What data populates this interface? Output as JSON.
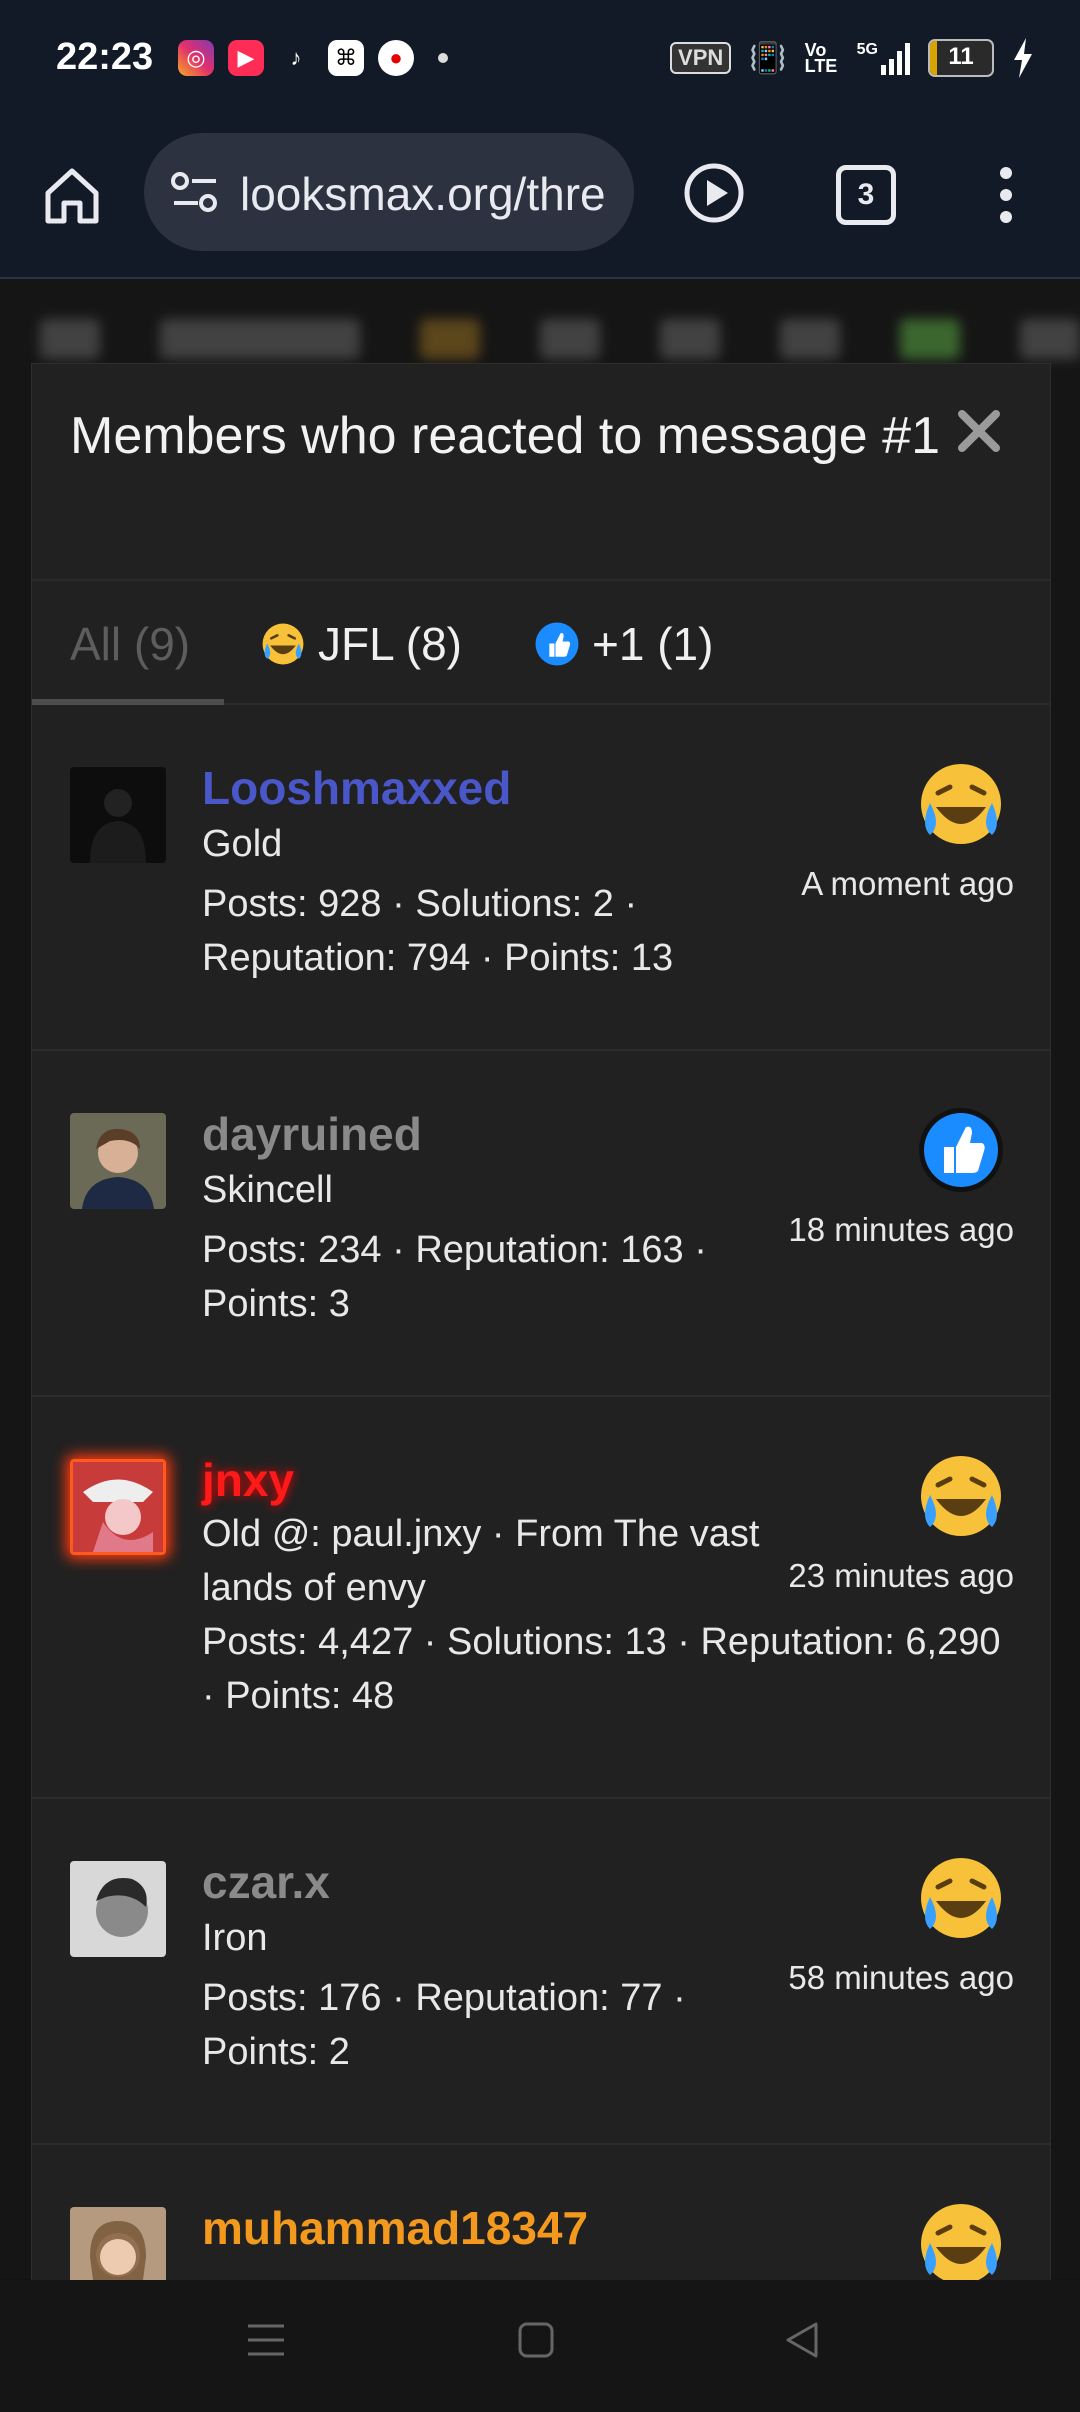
{
  "status_bar": {
    "time": "22:23",
    "apps": [
      "instagram-icon",
      "youtube-music-icon",
      "tiktok-icon",
      "capcut-icon",
      "vodafone-icon"
    ],
    "vpn": "VPN",
    "volte": "Vo LTE",
    "network": "5G",
    "battery": "11",
    "battery_level": 0.11
  },
  "browser": {
    "url": "looksmax.org/thre",
    "tab_count": "3"
  },
  "modal": {
    "title": "Members who reacted to message #1",
    "tabs": [
      {
        "label": "All (9)"
      },
      {
        "label": "JFL (8)"
      },
      {
        "label": "+1 (1)"
      }
    ],
    "members": [
      {
        "name": "Looshmaxxed",
        "name_color": "#4a57c8",
        "title": "Gold",
        "stats_1": "Posts: 928 · Solutions: 2 ·",
        "stats_2": "Reputation: 794 · Points: 13",
        "stats_3": "",
        "reaction": "jfl-emoji",
        "time": "A moment ago"
      },
      {
        "name": "dayruined",
        "name_color": "#8a8a8a",
        "title": "Skincell",
        "stats_1": "Posts: 234 · Reputation: 163 ·",
        "stats_2": "Points: 3",
        "stats_3": "",
        "reaction": "thumbs-up",
        "time": "18 minutes ago"
      },
      {
        "name": "jnxy",
        "name_color": "#ff1a1a",
        "title": "Old @: paul.jnxy · From The vast",
        "title_2": "lands of envy",
        "stats_1": "Posts: 4,427 · Solutions: 13 · Reputation: 6,290",
        "stats_2": "· Points: 48",
        "reaction": "jfl-emoji",
        "time": "23 minutes ago"
      },
      {
        "name": "czar.x",
        "name_color": "#8a8a8a",
        "title": "Iron",
        "stats_1": "Posts: 176 · Reputation: 77 ·",
        "stats_2": "Points: 2",
        "stats_3": "",
        "reaction": "jfl-emoji",
        "time": "58 minutes ago"
      },
      {
        "name": "muhammad18347",
        "name_color": "#f39a1e",
        "title": "",
        "stats_1": "",
        "stats_2": "",
        "stats_3": "",
        "reaction": "jfl-emoji",
        "time": ""
      }
    ]
  }
}
